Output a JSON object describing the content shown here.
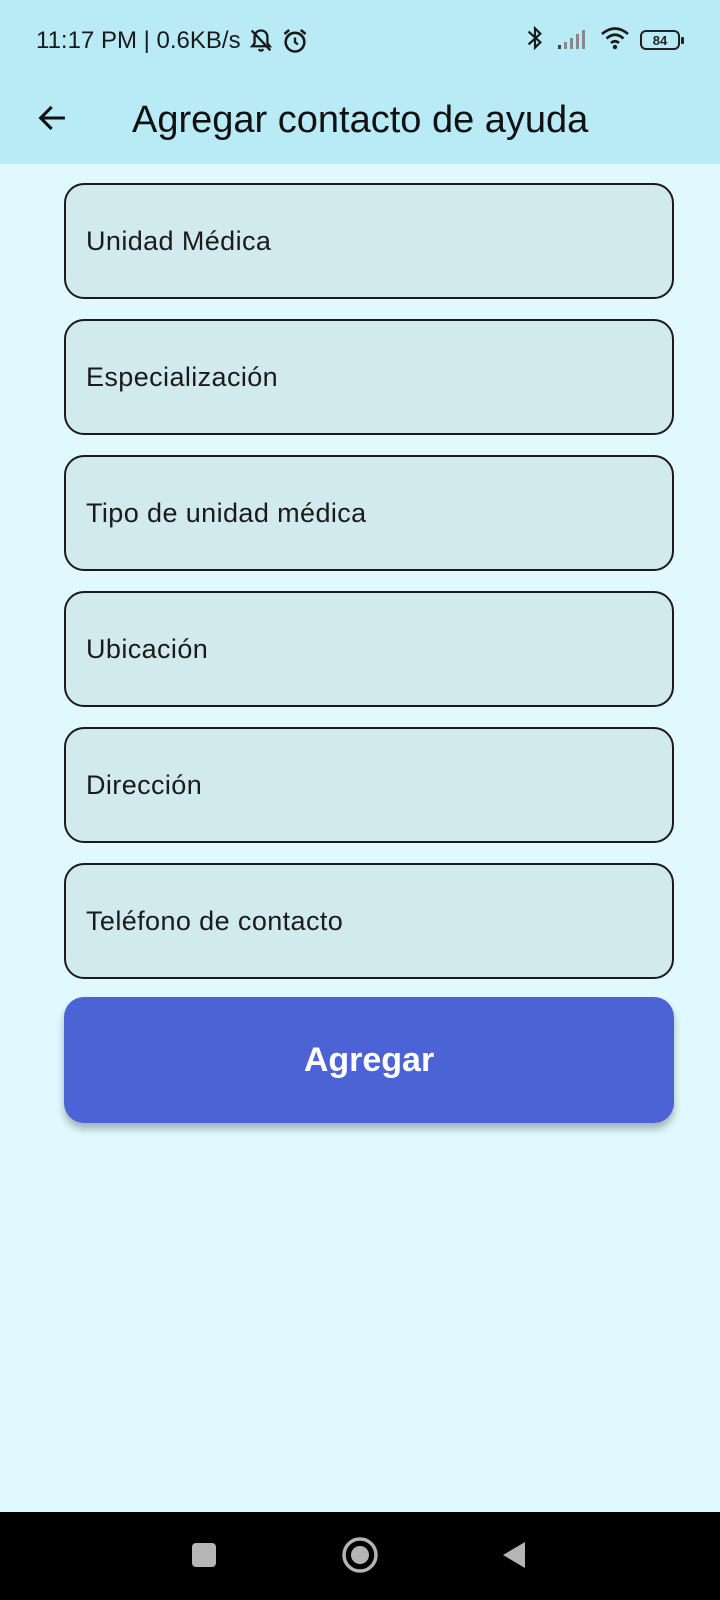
{
  "status_bar": {
    "time_speed": "11:17 PM | 0.6KB/s",
    "battery_level": "84",
    "icons": [
      "bell-off-icon",
      "alarm-icon",
      "bluetooth-icon",
      "signal-icon",
      "wifi-icon",
      "battery-icon"
    ]
  },
  "app_bar": {
    "title": "Agregar contacto de ayuda",
    "back_icon": "arrow-left-icon"
  },
  "form": {
    "fields": [
      {
        "placeholder": "Unidad Médica",
        "value": ""
      },
      {
        "placeholder": "Especialización",
        "value": ""
      },
      {
        "placeholder": "Tipo de unidad médica",
        "value": ""
      },
      {
        "placeholder": "Ubicación",
        "value": ""
      },
      {
        "placeholder": "Dirección",
        "value": ""
      },
      {
        "placeholder": "Teléfono de contacto",
        "value": ""
      }
    ],
    "submit_label": "Agregar"
  },
  "nav_bar": {
    "icons": [
      "recents-square-icon",
      "home-circle-icon",
      "back-triangle-icon"
    ]
  },
  "colors": {
    "background": "#e0f9fe",
    "app_bar": "#b8ebf6",
    "field_fill": "#d0eaee",
    "button": "#4b63d5",
    "button_text": "#ffffff"
  }
}
